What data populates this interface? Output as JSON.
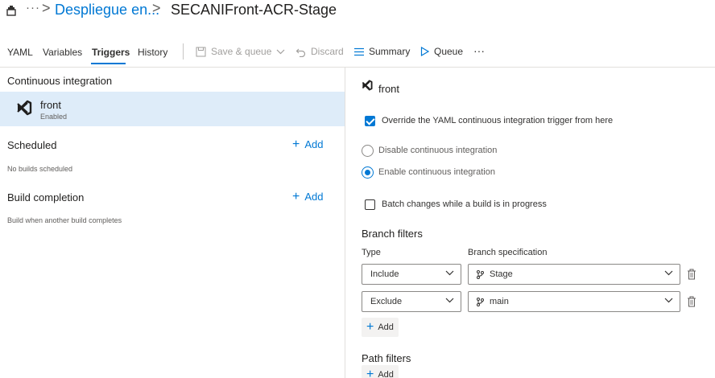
{
  "header": {
    "breadcrumb_more": "···",
    "project_link": "Despliegue en...",
    "chevron": ">",
    "pipeline_title": "SECANIFront-ACR-Stage"
  },
  "tabs": [
    {
      "label": "YAML"
    },
    {
      "label": "Variables"
    },
    {
      "label": "Triggers",
      "active": true
    },
    {
      "label": "History"
    }
  ],
  "toolbar": {
    "save_queue": "Save & queue",
    "discard": "Discard",
    "summary": "Summary",
    "queue": "Queue",
    "more": "···"
  },
  "left": {
    "ci_title": "Continuous integration",
    "ci_item": {
      "name": "front",
      "status": "Enabled"
    },
    "scheduled_title": "Scheduled",
    "scheduled_add": "Add",
    "scheduled_note": "No builds scheduled",
    "build_completion_title": "Build completion",
    "build_completion_add": "Add",
    "build_completion_note": "Build when another build completes"
  },
  "right": {
    "repo_name": "front",
    "override_label": "Override the YAML continuous integration trigger from here",
    "override_checked": true,
    "disable_ci_label": "Disable continuous integration",
    "enable_ci_label": "Enable continuous integration",
    "ci_selected": "enable",
    "batch_label": "Batch changes while a build is in progress",
    "batch_checked": false,
    "branch_filters_title": "Branch filters",
    "type_header": "Type",
    "branch_spec_header": "Branch specification",
    "filters": [
      {
        "type": "Include",
        "branch": "Stage"
      },
      {
        "type": "Exclude",
        "branch": "main"
      }
    ],
    "add_filter_label": "Add",
    "path_filters_title": "Path filters",
    "add_path_label": "Add"
  },
  "colors": {
    "accent": "#0078d4",
    "selected_row": "#deecf9",
    "text": "#323130"
  }
}
